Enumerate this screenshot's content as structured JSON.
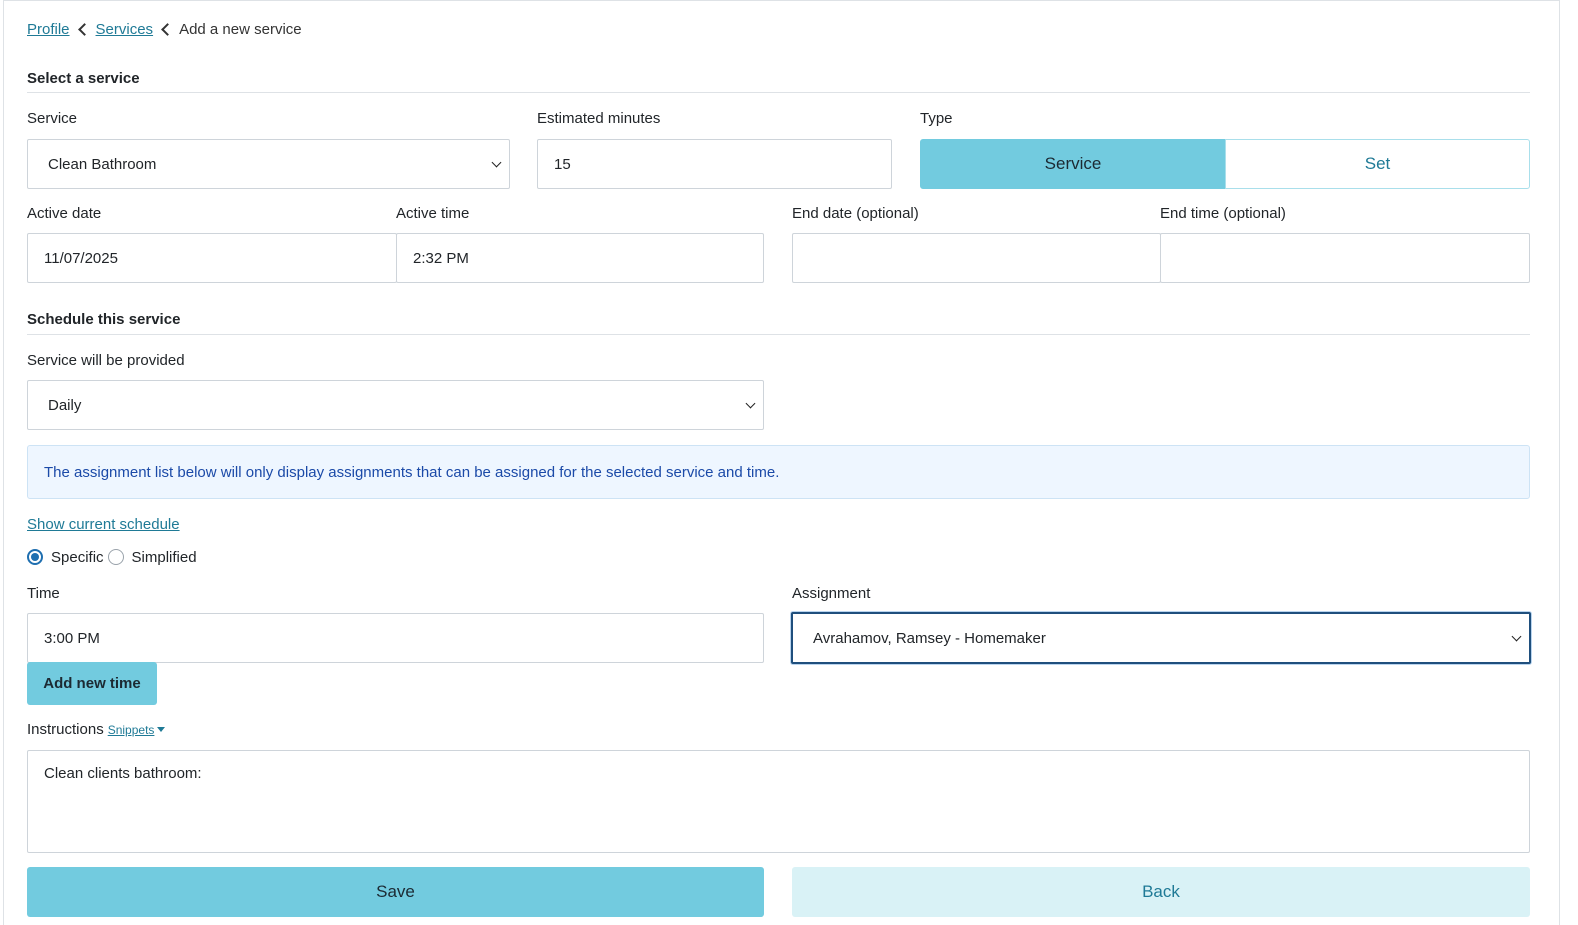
{
  "breadcrumb": {
    "profile": "Profile",
    "services": "Services",
    "current": "Add a new service"
  },
  "select_section": {
    "title": "Select a service",
    "service_label": "Service",
    "service_value": "Clean Bathroom",
    "minutes_label": "Estimated minutes",
    "minutes_value": "15",
    "type_label": "Type",
    "type_options": [
      "Service",
      "Set"
    ],
    "type_selected": "Service",
    "active_date_label": "Active date",
    "active_date_value": "11/07/2025",
    "active_time_label": "Active time",
    "active_time_value": "2:32 PM",
    "end_date_label": "End date (optional)",
    "end_date_value": "",
    "end_time_label": "End time (optional)",
    "end_time_value": ""
  },
  "schedule_section": {
    "title": "Schedule this service",
    "frequency_label": "Service will be provided",
    "frequency_value": "Daily",
    "info_text": "The assignment list below will only display assignments that can be assigned for the selected service and time.",
    "show_schedule_link": "Show current schedule",
    "mode_options": [
      "Specific",
      "Simplified"
    ],
    "mode_selected": "Specific",
    "time_label": "Time",
    "time_value": "3:00 PM",
    "assignment_label": "Assignment",
    "assignment_value": "Avrahamov, Ramsey - Homemaker",
    "add_time_button": "Add new time"
  },
  "instructions": {
    "label": "Instructions",
    "snippets_link": "Snippets",
    "value": "Clean clients bathroom:"
  },
  "actions": {
    "save": "Save",
    "back": "Back"
  },
  "colors": {
    "primary": "#72cbdf",
    "link": "#1f7a96",
    "info_bg": "#eef6ff",
    "info_text": "#1b4aa8",
    "secondary_bg": "#d9f2f6"
  }
}
